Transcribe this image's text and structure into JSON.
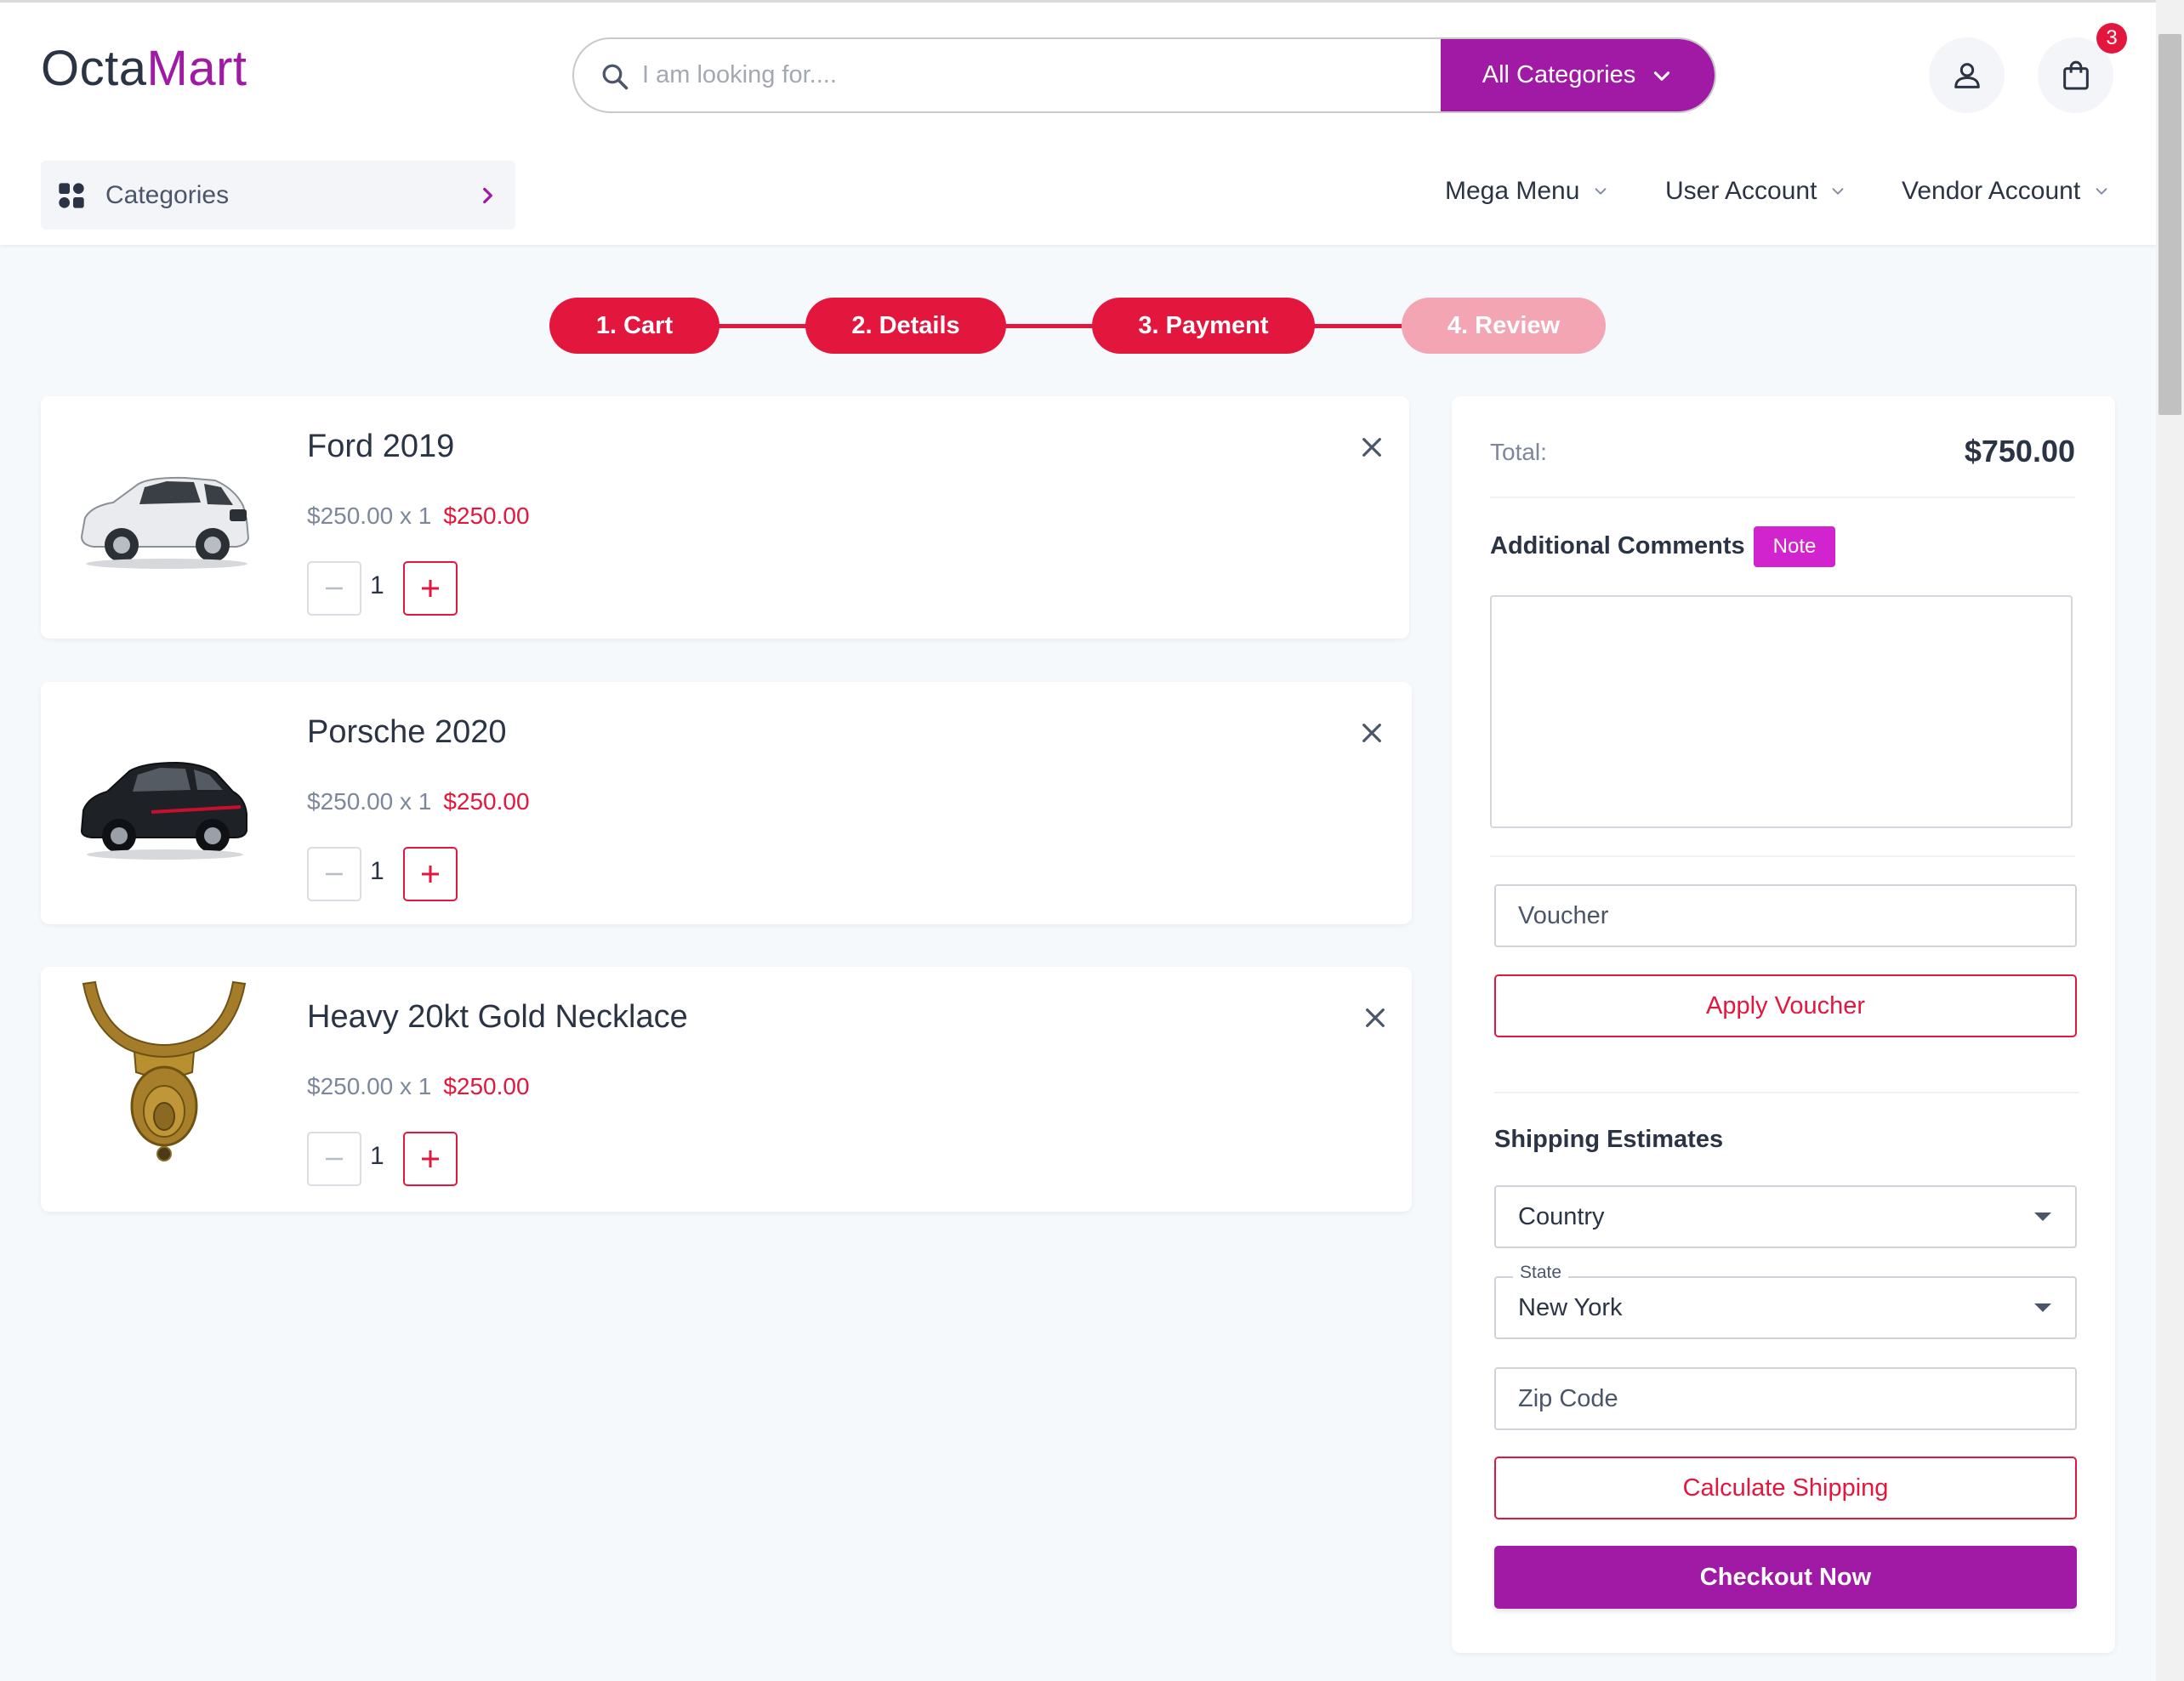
{
  "header": {
    "logo_part1": "Octa",
    "logo_part2": "Mart",
    "search_placeholder": "I am looking for....",
    "category_button": "All Categories",
    "cart_count": "3"
  },
  "nav": {
    "categories_label": "Categories",
    "mega_menu": "Mega Menu",
    "user_account": "User Account",
    "vendor_account": "Vendor Account"
  },
  "stepper": {
    "steps": [
      "1. Cart",
      "2. Details",
      "3. Payment",
      "4. Review"
    ],
    "active_count": 3
  },
  "cart": {
    "items": [
      {
        "name": "Ford 2019",
        "unit_price": "$250.00 x 1",
        "line_total": "$250.00",
        "qty": "1"
      },
      {
        "name": "Porsche 2020",
        "unit_price": "$250.00 x 1",
        "line_total": "$250.00",
        "qty": "1"
      },
      {
        "name": "Heavy 20kt Gold Necklace",
        "unit_price": "$250.00 x 1",
        "line_total": "$250.00",
        "qty": "1"
      }
    ]
  },
  "summary": {
    "total_label": "Total:",
    "total_value": "$750.00",
    "comments_label": "Additional Comments",
    "note_badge": "Note",
    "voucher_placeholder": "Voucher",
    "apply_voucher": "Apply Voucher",
    "shipping_title": "Shipping Estimates",
    "country_value": "Country",
    "state_label": "State",
    "state_value": "New York",
    "zip_placeholder": "Zip Code",
    "calculate_shipping": "Calculate Shipping",
    "checkout": "Checkout Now"
  },
  "colors": {
    "brand": "#a01aa6",
    "accent": "#e3173e",
    "note": "#d124cf",
    "step_pending": "#f3a5b3"
  }
}
